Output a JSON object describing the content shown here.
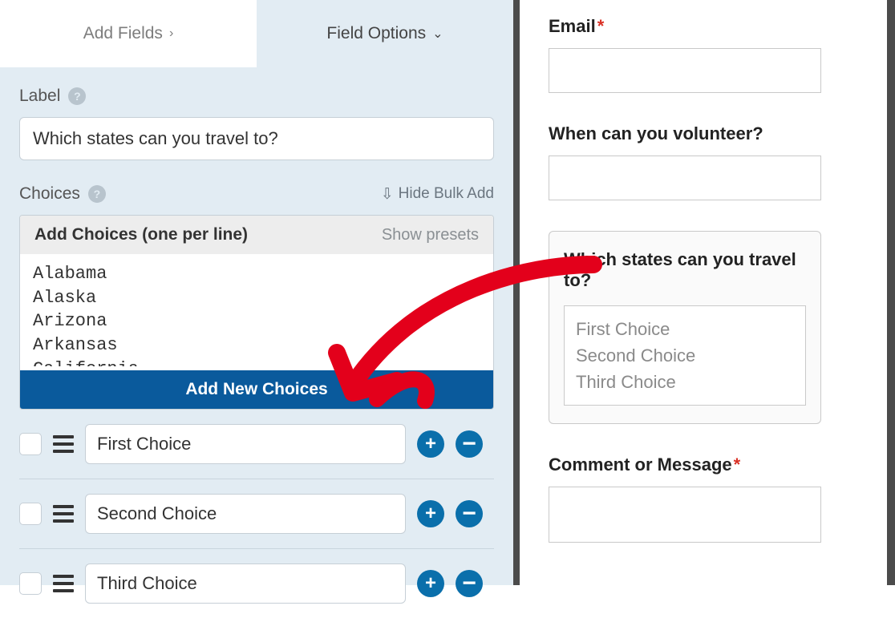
{
  "tabs": {
    "add_fields": "Add Fields",
    "field_options": "Field Options"
  },
  "label_section": {
    "title": "Label",
    "value": "Which states can you travel to?"
  },
  "choices_section": {
    "title": "Choices",
    "hide_bulk": "Hide Bulk Add",
    "bulk_title": "Add Choices (one per line)",
    "show_presets": "Show presets",
    "bulk_text": "Alabama\nAlaska\nArizona\nArkansas\nCalifornia",
    "add_new": "Add New Choices",
    "items": [
      {
        "label": "First Choice"
      },
      {
        "label": "Second Choice"
      },
      {
        "label": "Third Choice"
      }
    ]
  },
  "preview": {
    "email": {
      "label": "Email"
    },
    "volunteer": {
      "label": "When can you volunteer?"
    },
    "states_group": {
      "title": "Which states can you travel to?",
      "options": [
        "First Choice",
        "Second Choice",
        "Third Choice"
      ]
    },
    "comment": {
      "label": "Comment or Message"
    }
  }
}
